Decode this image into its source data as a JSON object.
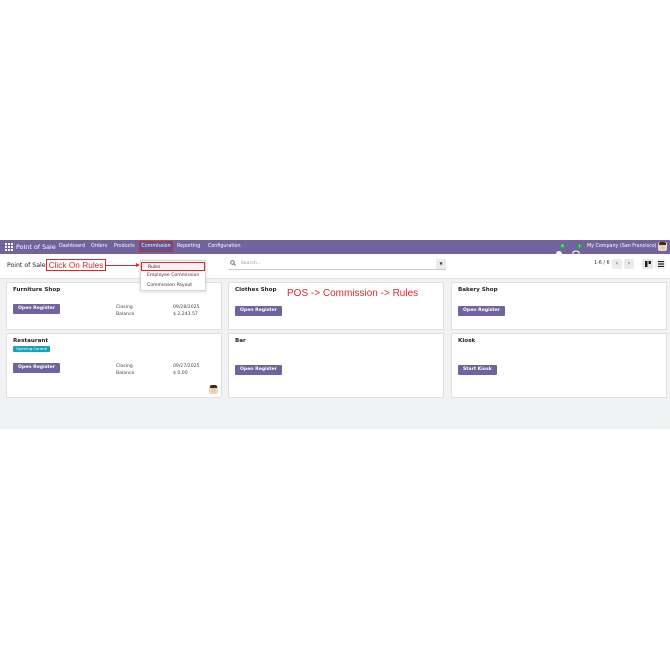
{
  "app_title": "Point of Sale",
  "navbar": {
    "menus": [
      "Dashboard",
      "Orders",
      "Products",
      "Commission",
      "Reporting",
      "Configuration"
    ],
    "activity_count": "6",
    "message_count": "1",
    "company": "My Company (San Francisco)"
  },
  "breadcrumb": "Point of Sale",
  "search": {
    "placeholder": "Search..."
  },
  "pager": {
    "text": "1-6 / 6"
  },
  "dropdown": {
    "items": [
      "Rules",
      "Employee Commission",
      "Commission Payout"
    ]
  },
  "annotations": {
    "click_label": "Click On Rules",
    "path_label": "POS -> Commission -> Rules"
  },
  "cards": [
    {
      "name": "Furniture Shop",
      "button": "Open Register",
      "closing_label": "Closing",
      "closing_date": "09/28/2025",
      "balance_label": "Balance",
      "balance_value": "$ 2,243.57"
    },
    {
      "name": "Clothes Shop",
      "button": "Open Register"
    },
    {
      "name": "Bakery Shop",
      "button": "Open Register"
    },
    {
      "name": "Restaurant",
      "tag": "Opening Control",
      "button": "Open Register",
      "closing_label": "Closing",
      "closing_date": "09/27/2025",
      "balance_label": "Balance",
      "balance_value": "$ 0.00"
    },
    {
      "name": "Bar",
      "button": "Open Register"
    },
    {
      "name": "Kiosk",
      "button": "Start Kiosk"
    }
  ],
  "colors": {
    "brand": "#71639e",
    "annotation": "#d9272e",
    "tag": "#17a2b8"
  }
}
